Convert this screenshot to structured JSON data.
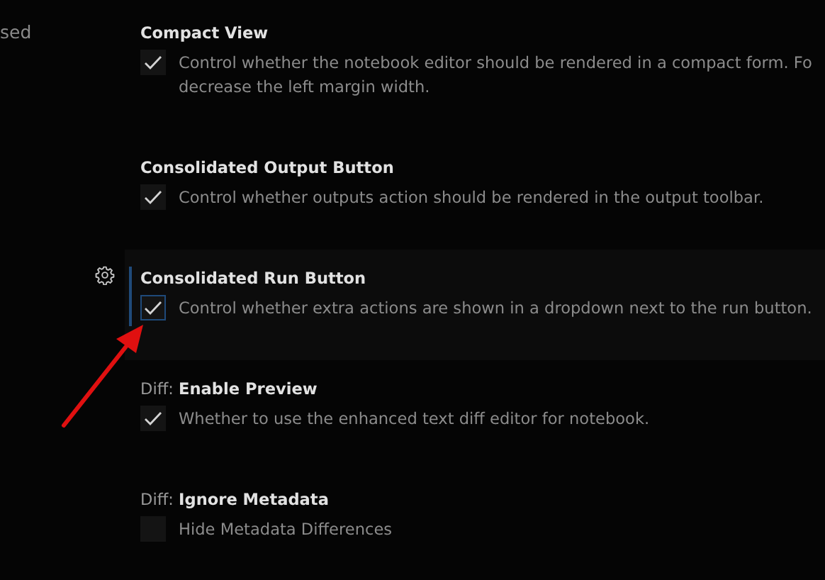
{
  "sidebar": {
    "items": [
      {
        "label": "sed"
      }
    ]
  },
  "settings": [
    {
      "title": "Compact View",
      "checked": true,
      "focused": false,
      "lines": [
        "Control whether the notebook editor should be rendered in a compact form. Fo",
        "decrease the left margin width."
      ]
    },
    {
      "title": "Consolidated Output Button",
      "checked": true,
      "focused": false,
      "lines": [
        "Control whether outputs action should be rendered in the output toolbar."
      ]
    },
    {
      "title": "Consolidated Run Button",
      "checked": true,
      "focused": true,
      "lines": [
        "Control whether extra actions are shown in a dropdown next to the run button."
      ]
    },
    {
      "category": "Diff: ",
      "title": "Enable Preview",
      "checked": true,
      "focused": false,
      "lines": [
        "Whether to use the enhanced text diff editor for notebook."
      ]
    },
    {
      "category": "Diff: ",
      "title": "Ignore Metadata",
      "checked": false,
      "focused": false,
      "lines": [
        "Hide Metadata Differences"
      ]
    }
  ]
}
